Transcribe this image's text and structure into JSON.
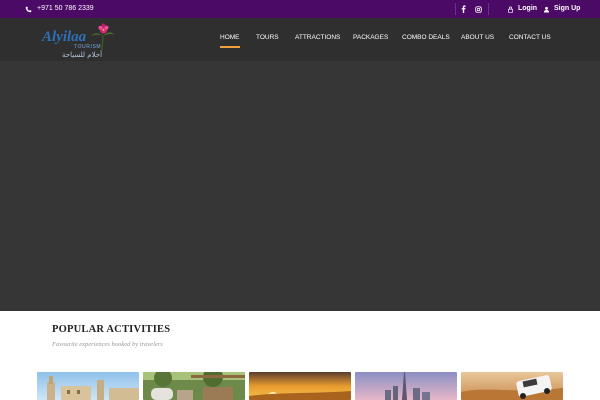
{
  "topbar": {
    "phone": "+971 50 786 2339",
    "login_label": "Login",
    "signup_label": "Sign Up"
  },
  "logo": {
    "latin_text": "Alyilaa",
    "sub_text": "TOURISM",
    "arabic_text": "أحلام للسياحة"
  },
  "nav": {
    "items": [
      {
        "label": "HOME",
        "active": true
      },
      {
        "label": "TOURS",
        "active": false
      },
      {
        "label": "ATTRACTIONS",
        "active": false
      },
      {
        "label": "PACKAGES",
        "active": false
      },
      {
        "label": "COMBO DEALS",
        "active": false
      },
      {
        "label": "ABOUT US",
        "active": false
      },
      {
        "label": "CONTACT US",
        "active": false
      }
    ]
  },
  "activities": {
    "title": "POPULAR ACTIVITIES",
    "subtitle": "Favourite experiences booked by travelers"
  },
  "colors": {
    "topbar": "#4b0a66",
    "nav": "#2f2f2f",
    "hero": "#363636",
    "accent": "#f0a03c"
  }
}
